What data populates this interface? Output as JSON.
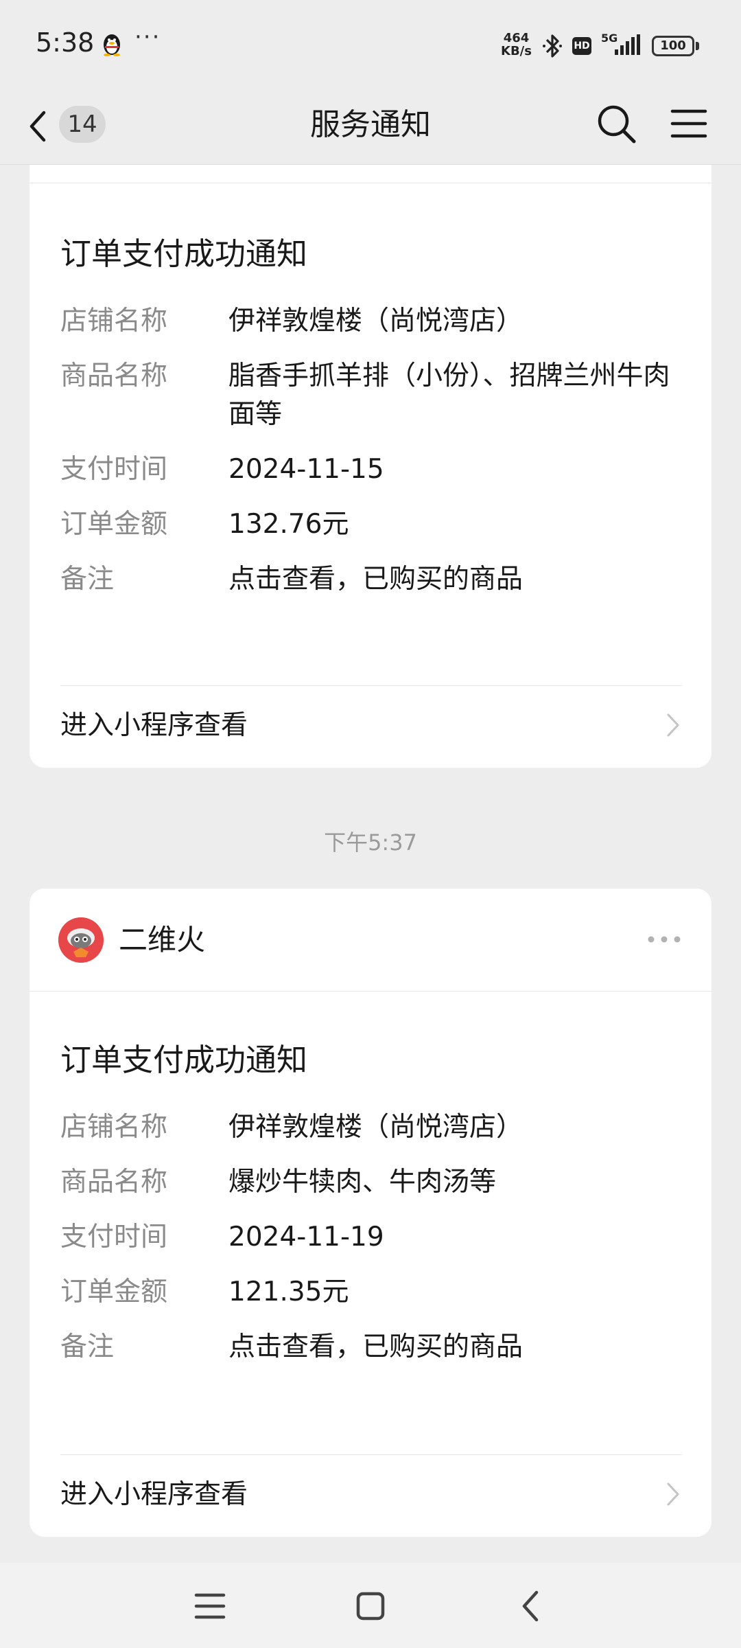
{
  "status_bar": {
    "time": "5:38",
    "more": "···",
    "net_speed_value": "464",
    "net_speed_unit": "KB/s",
    "hd": "HD",
    "network": "5G",
    "battery": "100"
  },
  "nav": {
    "unread_count": "14",
    "title": "服务通知"
  },
  "cards": [
    {
      "notice_title": "订单支付成功通知",
      "fields": [
        {
          "label": "店铺名称",
          "value": "伊祥敦煌楼（尚悦湾店）"
        },
        {
          "label": "商品名称",
          "value": "脂香手抓羊排（小份）、招牌兰州牛肉面等"
        },
        {
          "label": "支付时间",
          "value": "2024-11-15"
        },
        {
          "label": "订单金额",
          "value": "132.76元"
        },
        {
          "label": "备注",
          "value": "点击查看，已购买的商品"
        }
      ],
      "footer_label": "进入小程序查看"
    },
    {
      "brand_name": "二维火",
      "notice_title": "订单支付成功通知",
      "fields": [
        {
          "label": "店铺名称",
          "value": "伊祥敦煌楼（尚悦湾店）"
        },
        {
          "label": "商品名称",
          "value": "爆炒牛犊肉、牛肉汤等"
        },
        {
          "label": "支付时间",
          "value": "2024-11-19"
        },
        {
          "label": "订单金额",
          "value": "121.35元"
        },
        {
          "label": "备注",
          "value": "点击查看，已购买的商品"
        }
      ],
      "footer_label": "进入小程序查看"
    }
  ],
  "time_separator": "下午5:37",
  "icons": {
    "back": "chevron-left-icon",
    "search": "search-icon",
    "menu": "hamburger-icon",
    "more": "more-dots-icon",
    "footer": "chevron-right-icon"
  }
}
